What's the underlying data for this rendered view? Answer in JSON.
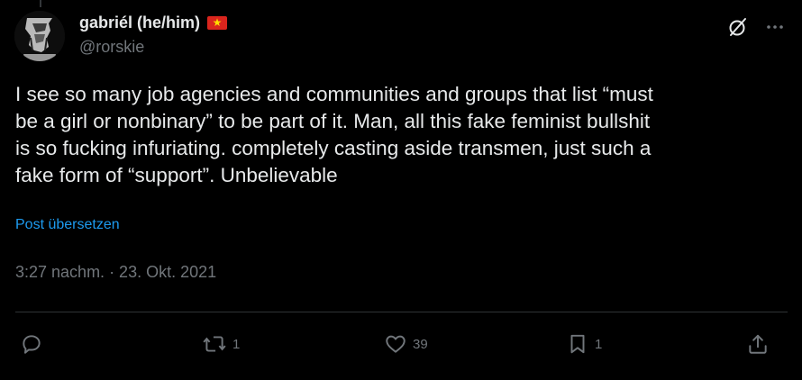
{
  "author": {
    "display_name": "gabriél (he/him)",
    "handle": "@rorskie",
    "flag_icon": "vietnam-flag-icon",
    "avatar_icon": "avatar-sketch-icon"
  },
  "header_actions": {
    "grok_icon": "grok-icon",
    "more_icon": "more-icon"
  },
  "tweet": {
    "text": "I see so many job agencies and communities and groups that list “must\nbe a girl or nonbinary” to be part of it. Man, all this fake feminist bullshit\nis so fucking infuriating. completely casting aside transmen, just such a\nfake form of “support”. Unbelievable",
    "translate_label": "Post übersetzen",
    "timestamp": "3:27 nachm. · 23. Okt. 2021"
  },
  "actions": {
    "reply": {
      "icon": "reply-icon",
      "count": ""
    },
    "repost": {
      "icon": "repost-icon",
      "count": "1"
    },
    "like": {
      "icon": "heart-icon",
      "count": "39"
    },
    "bookmark": {
      "icon": "bookmark-icon",
      "count": "1"
    },
    "share": {
      "icon": "share-icon",
      "count": ""
    }
  },
  "colors": {
    "background": "#000000",
    "text": "#e7e9ea",
    "muted": "#71767b",
    "link": "#1d9bf0",
    "divider": "#2f3336"
  }
}
